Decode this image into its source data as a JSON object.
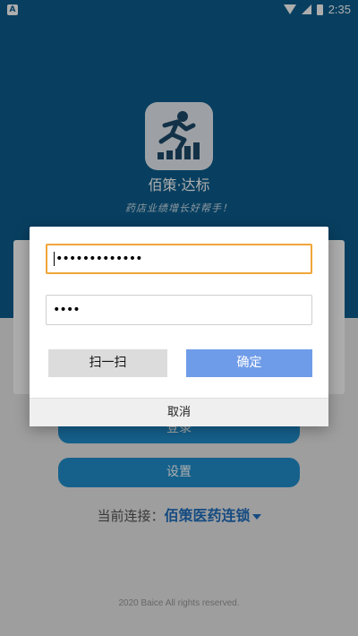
{
  "status_bar": {
    "time": "2:35",
    "left_icon": "android-icon",
    "icons": [
      "wifi-icon",
      "signal-icon",
      "battery-icon"
    ]
  },
  "app": {
    "name": "佰策·达标",
    "slogan": "药店业绩增长好帮手！",
    "logo": "runner-bars-logo"
  },
  "background": {
    "login_label": "登录",
    "settings_label": "设置",
    "connection_label": "当前连接：",
    "connection_value": "佰策医药连锁",
    "copyright": "2020 Baice All rights reserved."
  },
  "dialog": {
    "field1_value": "•••••••••••••",
    "field2_value": "••••",
    "scan_label": "扫一扫",
    "confirm_label": "确定",
    "cancel_label": "取消"
  },
  "colors": {
    "brand_blue": "#0d5d8e",
    "button_blue": "#1f8fcf",
    "confirm_blue": "#6f9ce8",
    "focus_orange": "#f0a63a"
  }
}
